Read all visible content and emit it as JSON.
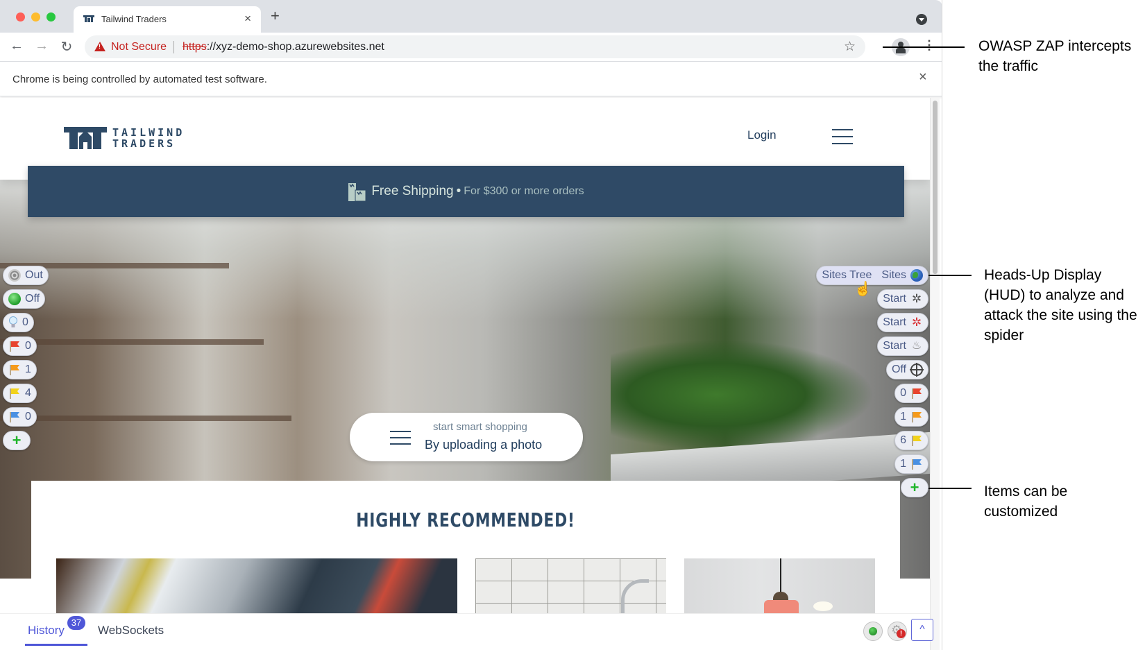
{
  "browser": {
    "tab_title": "Tailwind Traders",
    "tab_close": "×",
    "new_tab": "+",
    "back": "←",
    "forward": "→",
    "reload": "↻",
    "security_label": "Not Secure",
    "url_scheme": "https",
    "url_rest": "://xyz-demo-shop.azurewebsites.net",
    "star": "☆",
    "menu": "⋮",
    "infobar_text": "Chrome is being controlled by automated test software.",
    "infobar_close": "×"
  },
  "site": {
    "logo_line1": "TAILWIND",
    "logo_line2": "TRADERS",
    "login": "Login",
    "banner_strong": "Free Shipping",
    "banner_sep": "•",
    "banner_light": "For $300 or more orders",
    "search_sub": "start smart shopping",
    "search_main": "By uploading a photo",
    "section_title": "HIGHLY RECOMMENDED!"
  },
  "hud": {
    "left": [
      {
        "icon": "target-icon",
        "label": "Out"
      },
      {
        "icon": "green-dot-icon",
        "label": "Off"
      },
      {
        "icon": "lightbulb-icon",
        "label": "0"
      },
      {
        "icon": "red-flag-icon",
        "label": "0",
        "color": "#e8442e"
      },
      {
        "icon": "orange-flag-icon",
        "label": "1",
        "color": "#f59a1b"
      },
      {
        "icon": "yellow-flag-icon",
        "label": "4",
        "color": "#f2d21b"
      },
      {
        "icon": "blue-flag-icon",
        "label": "0",
        "color": "#4a90e2"
      },
      {
        "icon": "plus-icon",
        "label": ""
      }
    ],
    "right": [
      {
        "icon": "globe-icon",
        "label": "Sites",
        "tooltip": "Sites Tree"
      },
      {
        "icon": "spider-icon",
        "label": "Start"
      },
      {
        "icon": "ajax-spider-icon",
        "label": "Start"
      },
      {
        "icon": "flame-icon",
        "label": "Start"
      },
      {
        "icon": "crosshair-icon",
        "label": "Off"
      },
      {
        "icon": "red-flag-icon",
        "label": "0",
        "color": "#e8442e"
      },
      {
        "icon": "orange-flag-icon",
        "label": "1",
        "color": "#f59a1b"
      },
      {
        "icon": "yellow-flag-icon",
        "label": "6",
        "color": "#f2d21b"
      },
      {
        "icon": "blue-flag-icon",
        "label": "1",
        "color": "#4a90e2"
      },
      {
        "icon": "plus-icon",
        "label": ""
      }
    ],
    "bottom": {
      "history_label": "History",
      "history_count": "37",
      "websockets_label": "WebSockets",
      "expand": "^"
    }
  },
  "annotations": [
    {
      "text": "OWASP ZAP intercepts the traffic"
    },
    {
      "text": "Heads-Up Display (HUD) to analyze and attack the site using the spider"
    },
    {
      "text": "Items can be customized"
    }
  ],
  "colors": {
    "brand_navy": "#2e4a66",
    "hud_accent": "#4f57d8",
    "warning_red": "#c5221f"
  }
}
